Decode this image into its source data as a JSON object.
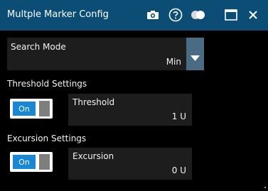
{
  "dialog": {
    "title": "Multple Marker Config",
    "icons": [
      "camera-icon",
      "help-icon",
      "toggle-visibility-icon",
      "maximize-icon",
      "close-icon"
    ]
  },
  "search_mode": {
    "label": "Search Mode",
    "value": "Min"
  },
  "threshold_settings": {
    "title": "Threshold Settings",
    "toggle_label": "On",
    "field_label": "Threshold",
    "field_value": "1 U"
  },
  "excursion_settings": {
    "title": "Excursion Settings",
    "toggle_label": "On",
    "field_label": "Excursion",
    "field_value": "0 U"
  },
  "colors": {
    "titlebar": "#0b4d74",
    "panel": "#1d1d1d",
    "toggle_on": "#1a86d6",
    "dropdown_button": "#4a6b84"
  }
}
